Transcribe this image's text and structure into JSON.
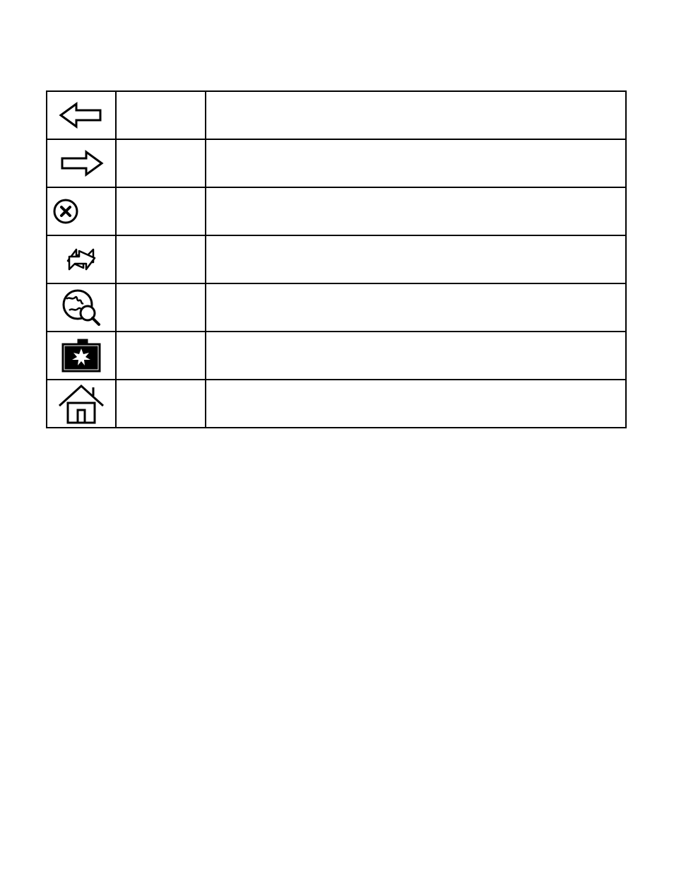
{
  "table": {
    "rows": [
      {
        "icon": "arrow-left-icon",
        "col2": "",
        "col3": ""
      },
      {
        "icon": "arrow-right-icon",
        "col2": "",
        "col3": ""
      },
      {
        "icon": "stop-icon",
        "col2": "",
        "col3": ""
      },
      {
        "icon": "refresh-icon",
        "col2": "",
        "col3": ""
      },
      {
        "icon": "globe-search-icon",
        "col2": "",
        "col3": ""
      },
      {
        "icon": "camera-icon",
        "col2": "",
        "col3": ""
      },
      {
        "icon": "home-icon",
        "col2": "",
        "col3": ""
      }
    ]
  }
}
